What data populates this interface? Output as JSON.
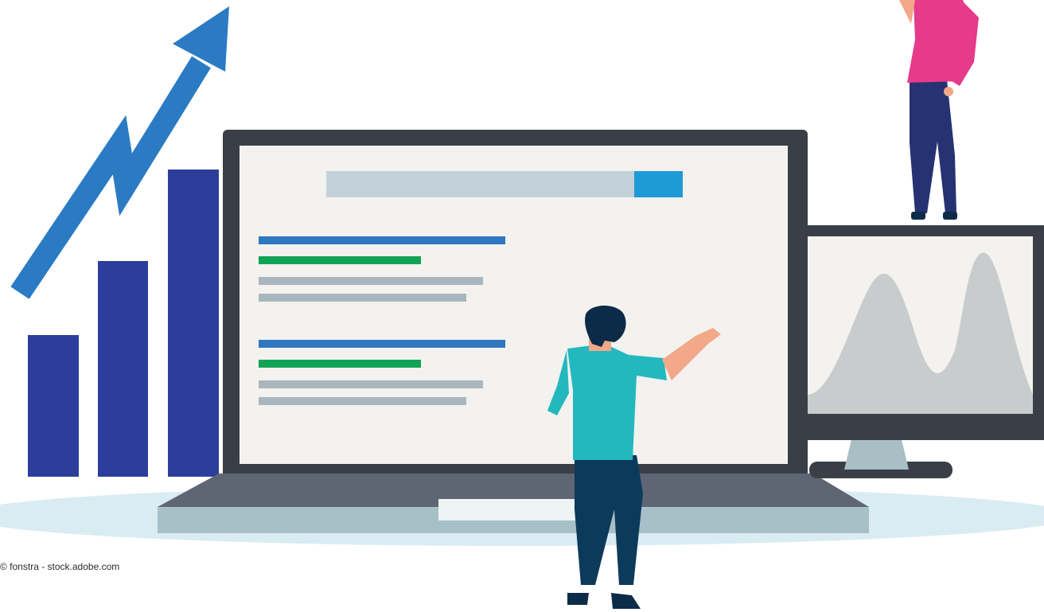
{
  "illustration": {
    "name": "seo-search-results-illustration",
    "colors": {
      "ground": "#d9ecf2",
      "bars": "#2c3e9b",
      "arrow": "#2a7bc4",
      "laptop_frame": "#3a3f47",
      "laptop_base": "#5f6673",
      "laptop_tray": "#a7c0c8",
      "screen": "#f3f2ef",
      "search_bar": "#c3d2da",
      "search_button": "#1e9ad6",
      "result_title": "#2f77c0",
      "result_url": "#12a356",
      "result_text": "#a9b6bd",
      "monitor_frame": "#3a3f47",
      "monitor_chart": "#c9cccd",
      "shirt_teal": "#22b8be",
      "pants_navy": "#0c3a5a",
      "shirt_pink": "#e63a8a",
      "pants_purple": "#263272"
    },
    "icons": [
      "growth-bar-chart",
      "up-trend-arrow",
      "search-bar",
      "search-result-list",
      "bell-curve-chart"
    ]
  },
  "credit": "© fonstra - stock.adobe.com"
}
